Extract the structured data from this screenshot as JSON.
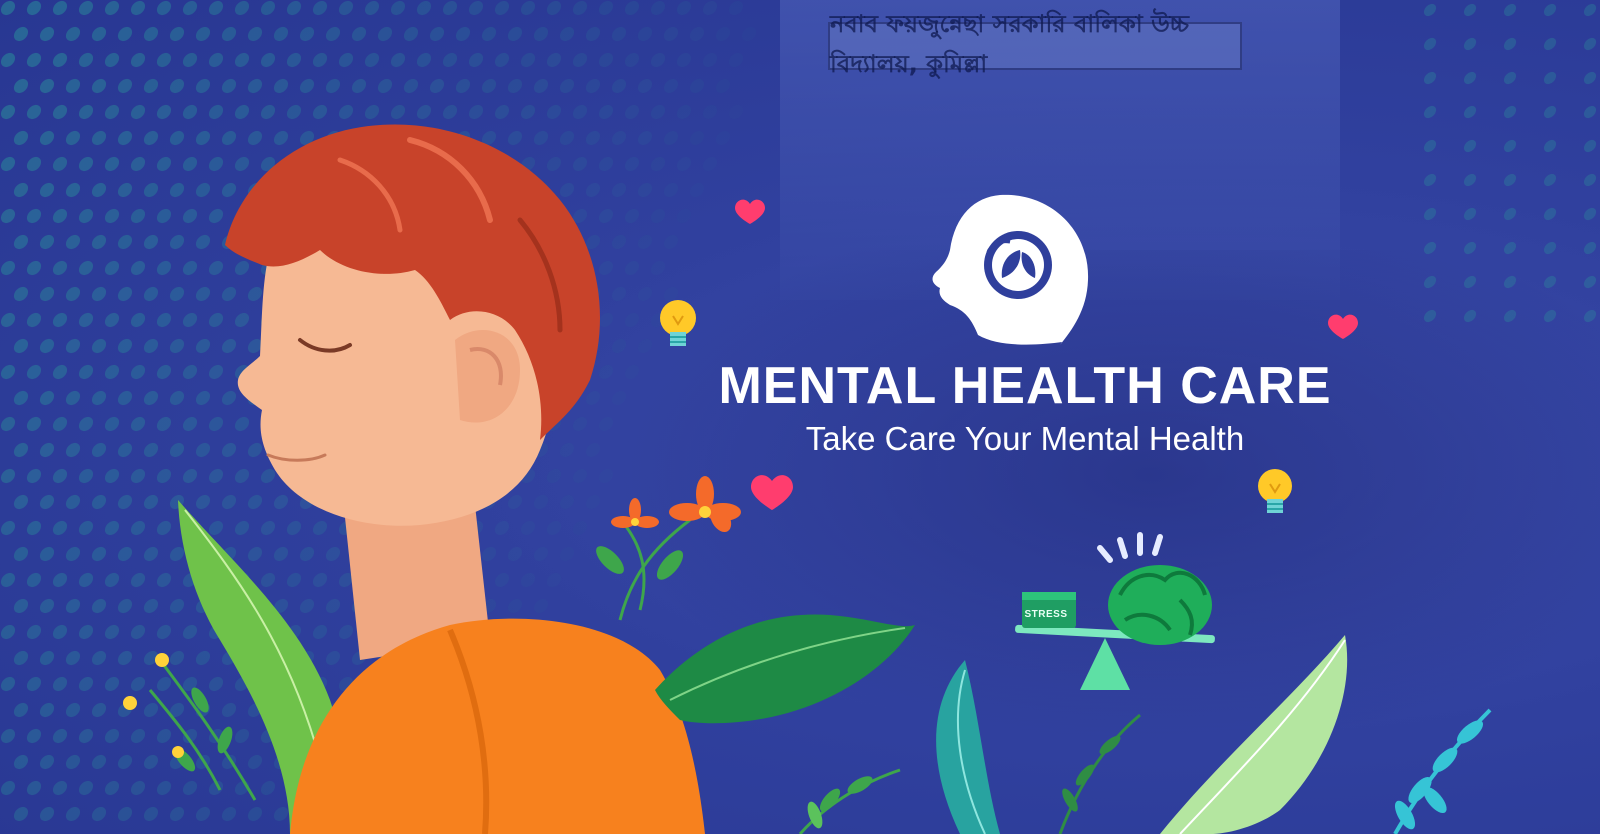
{
  "banner": {
    "title": "MENTAL HEALTH CARE",
    "subtitle": "Take Care Your Mental Health",
    "building_sign": "নবাব ফয়জুন্নেছা সরকারি বালিকা উচ্চ বিদ্যালয়, কুমিল্লা",
    "stress_label": "STRESS"
  },
  "colors": {
    "background": "#2f3f9c",
    "dot_pattern": "#2a8f9a",
    "hair": "#c8432a",
    "skin": "#f6b994",
    "shirt": "#f7811e",
    "leaf_green": "#3ea64b",
    "brain_green": "#1fae5a",
    "heart": "#ff3d6e",
    "bulb": "#ffc928",
    "text": "#ffffff"
  },
  "icons": [
    "head-leaf-logo-icon",
    "heart-icon",
    "lightbulb-icon",
    "brain-icon",
    "balance-scale-icon"
  ]
}
